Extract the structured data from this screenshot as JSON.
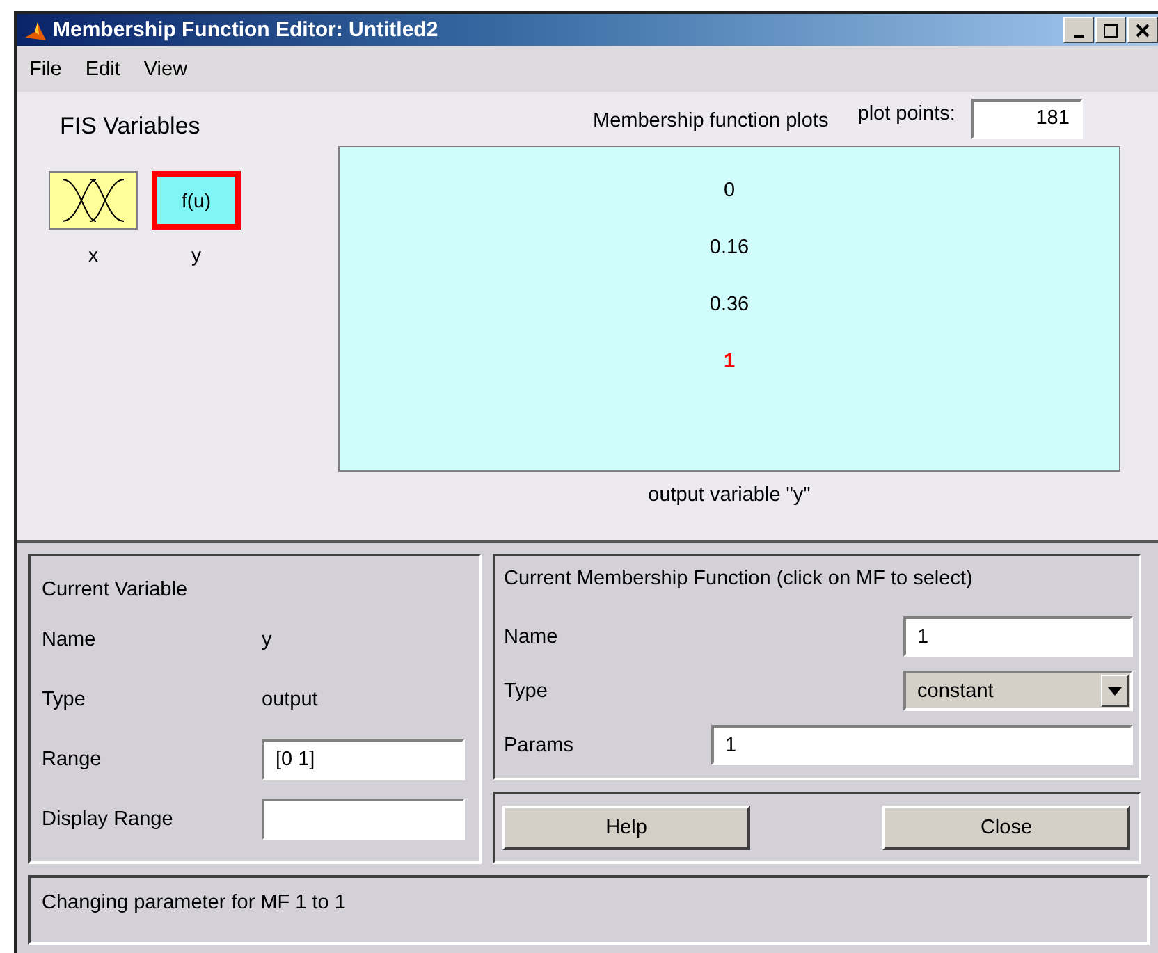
{
  "window": {
    "title": "Membership Function Editor: Untitled2"
  },
  "menu": [
    "File",
    "Edit",
    "View"
  ],
  "fis_variables": {
    "title": "FIS Variables",
    "items": [
      {
        "name": "x",
        "kind": "input",
        "selected": false
      },
      {
        "name": "y",
        "kind": "output",
        "icon_text": "f(u)",
        "selected": true
      }
    ]
  },
  "plot": {
    "title": "Membership function plots",
    "plot_points_label": "plot points:",
    "plot_points": "181",
    "xlabel": "output variable \"y\"",
    "mfs": [
      {
        "name": "0",
        "selected": false
      },
      {
        "name": "0.16",
        "selected": false
      },
      {
        "name": "0.36",
        "selected": false
      },
      {
        "name": "1",
        "selected": true
      }
    ]
  },
  "current_variable": {
    "title": "Current Variable",
    "name_label": "Name",
    "name": "y",
    "type_label": "Type",
    "type": "output",
    "range_label": "Range",
    "range": "[0 1]",
    "display_range_label": "Display Range"
  },
  "current_mf": {
    "title": "Current Membership Function (click on MF to select)",
    "name_label": "Name",
    "name": "1",
    "type_label": "Type",
    "type": "constant",
    "params_label": "Params",
    "params": "1"
  },
  "buttons": [
    "Help",
    "Close"
  ],
  "status": "Changing parameter for MF 1 to 1"
}
